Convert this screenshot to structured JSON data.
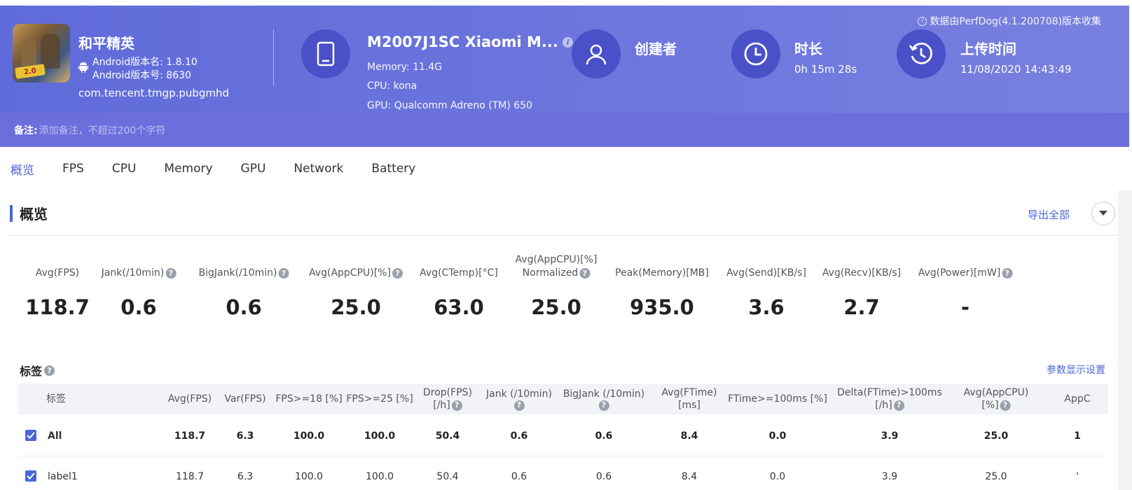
{
  "header": {
    "source_note": "数据由PerfDog(4.1.200708)版本收集",
    "app_name": "和平精英",
    "android_version_name": "Android版本名: 1.8.10",
    "android_version_code": "Android版本号: 8630",
    "package": "com.tencent.tmgp.pubgmhd",
    "app_icon_badge": "2.0",
    "device_title": "M2007J1SC Xiaomi M...",
    "memory": "Memory: 11.4G",
    "cpu": "CPU: kona",
    "gpu": "GPU: Qualcomm Adreno (TM) 650",
    "creator_label": "创建者",
    "duration_label": "时长",
    "duration_value": "0h 15m 28s",
    "upload_label": "上传时间",
    "upload_value": "11/08/2020 14:43:49",
    "remark_label": "备注:",
    "remark_placeholder": "添加备注，不超过200个字符"
  },
  "tabs": [
    "概览",
    "FPS",
    "CPU",
    "Memory",
    "GPU",
    "Network",
    "Battery"
  ],
  "overview": {
    "title": "概览",
    "export_all": "导出全部",
    "metrics": [
      {
        "label": "Avg(FPS)",
        "label2": "",
        "value": "118.7",
        "help": false
      },
      {
        "label": "Jank(/10min)",
        "label2": "",
        "value": "0.6",
        "help": true
      },
      {
        "label": "BigJank(/10min)",
        "label2": "",
        "value": "0.6",
        "help": true
      },
      {
        "label": "Avg(AppCPU)[%]",
        "label2": "",
        "value": "25.0",
        "help": true
      },
      {
        "label": "Avg(CTemp)[°C]",
        "label2": "",
        "value": "63.0",
        "help": false
      },
      {
        "label": "Avg(AppCPU)[%]",
        "label2": "Normalized",
        "value": "25.0",
        "help": true
      },
      {
        "label": "Peak(Memory)[MB]",
        "label2": "",
        "value": "935.0",
        "help": false
      },
      {
        "label": "Avg(Send)[KB/s]",
        "label2": "",
        "value": "3.6",
        "help": false
      },
      {
        "label": "Avg(Recv)[KB/s]",
        "label2": "",
        "value": "2.7",
        "help": false
      },
      {
        "label": "Avg(Power)[mW]",
        "label2": "",
        "value": "-",
        "help": true
      }
    ]
  },
  "labels": {
    "title": "标签",
    "param_settings": "参数显示设置",
    "columns": [
      {
        "l1": "标签",
        "l2": "",
        "help": false
      },
      {
        "l1": "Avg(FPS)",
        "l2": "",
        "help": false
      },
      {
        "l1": "Var(FPS)",
        "l2": "",
        "help": false
      },
      {
        "l1": "FPS>=18 [%]",
        "l2": "",
        "help": false
      },
      {
        "l1": "FPS>=25 [%]",
        "l2": "",
        "help": false
      },
      {
        "l1": "Drop(FPS)",
        "l2": "[/h]",
        "help": true
      },
      {
        "l1": "Jank (/10min)",
        "l2": "",
        "help": true
      },
      {
        "l1": "BigJank (/10min)",
        "l2": "",
        "help": true
      },
      {
        "l1": "Avg(FTime)",
        "l2": "[ms]",
        "help": false
      },
      {
        "l1": "FTime>=100ms [%]",
        "l2": "",
        "help": false
      },
      {
        "l1": "Delta(FTime)>100ms",
        "l2": "[/h]",
        "help": true
      },
      {
        "l1": "Avg(AppCPU)",
        "l2": "[%]",
        "help": true
      },
      {
        "l1": "AppC",
        "l2": "",
        "help": false
      }
    ],
    "rows": [
      {
        "label": "All",
        "checked": true,
        "bold": true,
        "values": [
          "118.7",
          "6.3",
          "100.0",
          "100.0",
          "50.4",
          "0.6",
          "0.6",
          "8.4",
          "0.0",
          "3.9",
          "25.0",
          "1"
        ]
      },
      {
        "label": "label1",
        "checked": true,
        "bold": false,
        "values": [
          "118.7",
          "6.3",
          "100.0",
          "100.0",
          "50.4",
          "0.6",
          "0.6",
          "8.4",
          "0.0",
          "3.9",
          "25.0",
          "'"
        ]
      }
    ]
  },
  "colors": {
    "banner": "#6a74dc",
    "accent": "#4a66d6",
    "icon_circle": "#4a50c8"
  }
}
